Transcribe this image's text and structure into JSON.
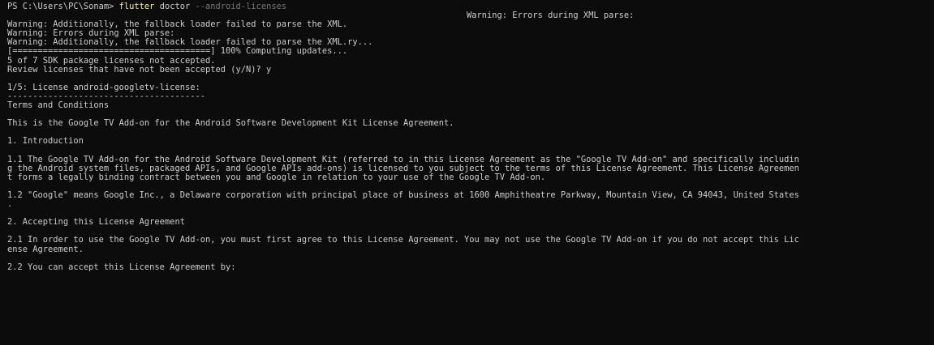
{
  "terminal": {
    "prompt": "PS C:\\Users\\PC\\Sonam> ",
    "command": "flutter",
    "command_args": " doctor",
    "command_flag": " --android-licenses",
    "indented_warning": "Warning: Errors during XML parse:",
    "lines": [
      "Warning: Additionally, the fallback loader failed to parse the XML.",
      "Warning: Errors during XML parse:",
      "Warning: Additionally, the fallback loader failed to parse the XML.ry...",
      "[=======================================] 100% Computing updates...",
      "5 of 7 SDK package licenses not accepted.",
      "Review licenses that have not been accepted (y/N)? y",
      "",
      "1/5: License android-googletv-license:",
      "---------------------------------------",
      "Terms and Conditions",
      "",
      "This is the Google TV Add-on for the Android Software Development Kit License Agreement.",
      "",
      "1. Introduction",
      "",
      "1.1 The Google TV Add-on for the Android Software Development Kit (referred to in this License Agreement as the \"Google TV Add-on\" and specifically includin",
      "g the Android system files, packaged APIs, and Google APIs add-ons) is licensed to you subject to the terms of this License Agreement. This License Agreemen",
      "t forms a legally binding contract between you and Google in relation to your use of the Google TV Add-on.",
      "",
      "1.2 \"Google\" means Google Inc., a Delaware corporation with principal place of business at 1600 Amphitheatre Parkway, Mountain View, CA 94043, United States",
      ".",
      "",
      "2. Accepting this License Agreement",
      "",
      "2.1 In order to use the Google TV Add-on, you must first agree to this License Agreement. You may not use the Google TV Add-on if you do not accept this Lic",
      "ense Agreement.",
      "",
      "2.2 You can accept this License Agreement by:"
    ],
    "colors": {
      "background": "#0c0c0c",
      "foreground": "#cccccc",
      "command": "#f9f1a5",
      "flag": "#767676"
    }
  }
}
